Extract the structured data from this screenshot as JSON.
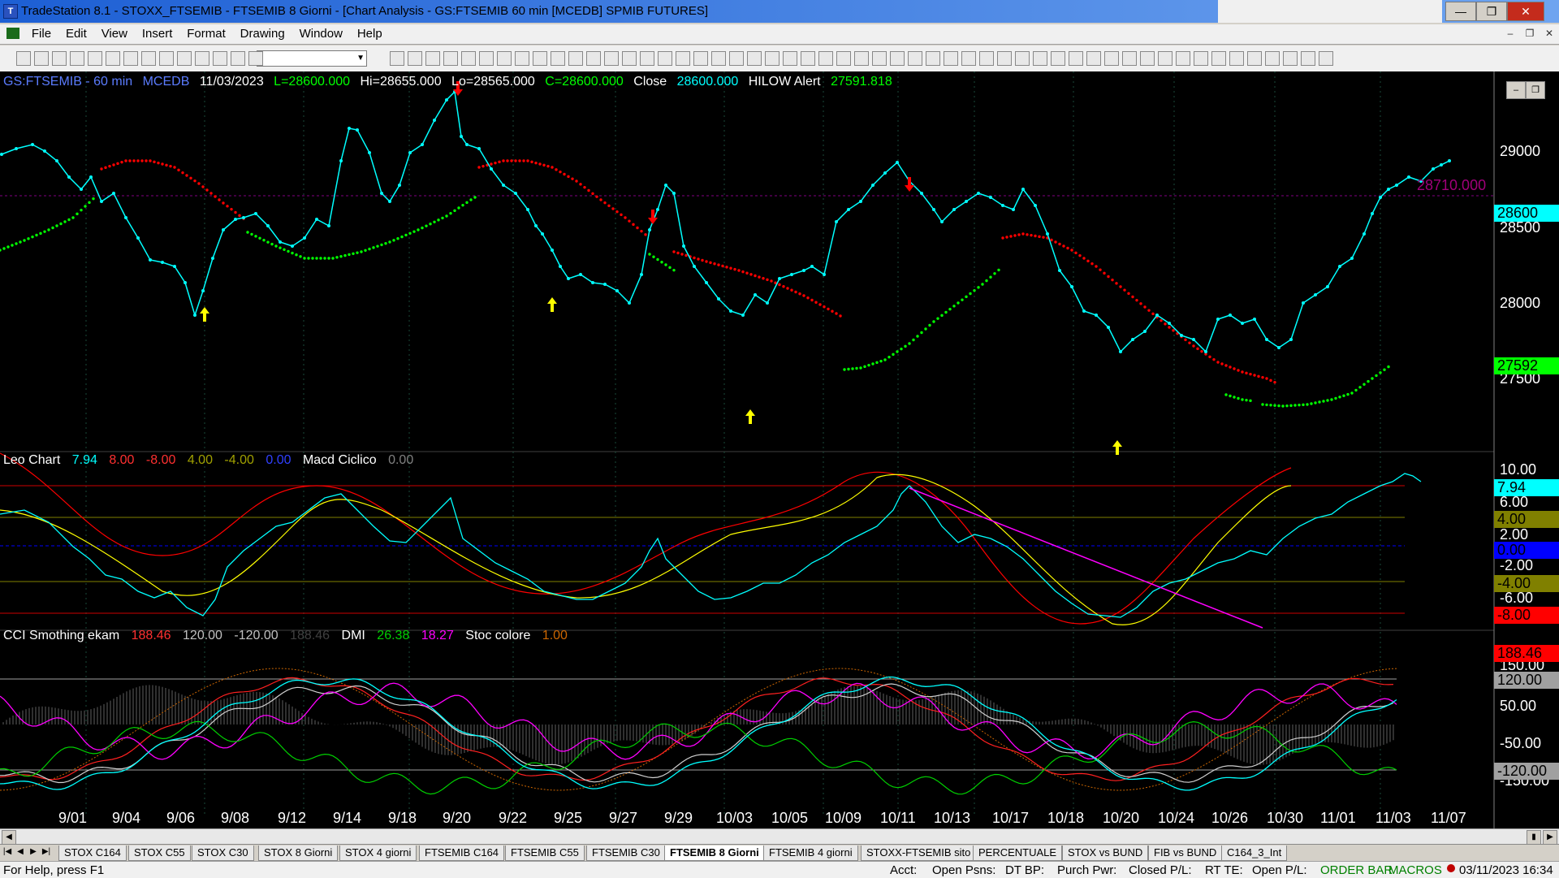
{
  "window": {
    "title": "TradeStation 8.1 - STOXX_FTSEMIB - FTSEMIB  8 Giorni - [Chart Analysis - GS:FTSEMIB  60 min  [MCEDB] SPMIB FUTURES]",
    "minimize": "—",
    "restore": "❐",
    "close": "✕"
  },
  "menu": [
    "File",
    "Edit",
    "View",
    "Insert",
    "Format",
    "Drawing",
    "Window",
    "Help"
  ],
  "chart_header": {
    "symbol": "GS:FTSEMIB - 60 min",
    "data_feed": "MCEDB",
    "date": "11/03/2023",
    "low_label": "L=28600.000",
    "high_label": "Hi=28655.000",
    "lo_label": "Lo=28565.000",
    "close_label": "C=28600.000",
    "close_word": "Close",
    "close_value": "28600.000",
    "alert_name": "HILOW Alert",
    "alert_value": "27591.818"
  },
  "price_axis": {
    "labels": [
      "29000",
      "28500",
      "28000",
      "27500"
    ],
    "ref_value_label": "28710.000",
    "current_tag": "28600",
    "alert_tag": "27592"
  },
  "macd_panel": {
    "name": "Leo Chart",
    "v1": "7.94",
    "v2": "8.00",
    "v3": "-8.00",
    "v4": "4.00",
    "v5": "-4.00",
    "v6": "0.00",
    "name2": "Macd Ciclico",
    "v7": "0.00",
    "axis": [
      "10.00",
      "6.00",
      "2.00",
      "-2.00",
      "-6.00"
    ],
    "tags": {
      "current": "7.94",
      "upper": "4.00",
      "zero": "0.00",
      "lower": "-4.00",
      "bottom": "-8.00"
    }
  },
  "cci_panel": {
    "name": "CCI Smothing ekam",
    "v1": "188.46",
    "v2": "120.00",
    "v3": "-120.00",
    "v4": "188.46",
    "dmi_name": "DMI",
    "dmi1": "26.38",
    "dmi2": "18.27",
    "stoc_name": "Stoc colore",
    "stoc_val": "1.00",
    "axis": [
      "150.00",
      "50.00",
      "-50.00",
      "-150.00"
    ],
    "tags": {
      "current": "188.46",
      "upper": "120.00",
      "lower": "-120.00"
    }
  },
  "date_axis": [
    "9/01",
    "9/04",
    "9/06",
    "9/08",
    "9/12",
    "9/14",
    "9/18",
    "9/20",
    "9/22",
    "9/25",
    "9/27",
    "9/29",
    "10/03",
    "10/05",
    "10/09",
    "10/11",
    "10/13",
    "10/17",
    "10/18",
    "10/20",
    "10/24",
    "10/26",
    "10/30",
    "11/01",
    "11/03",
    "11/07"
  ],
  "tabs": [
    "STOX C164",
    "STOX C55",
    "STOX  C30",
    "STOX  8 Giorni",
    "STOX 4 giorni",
    "FTSEMIB C164",
    "FTSEMIB C55",
    "FTSEMIB C30",
    "FTSEMIB  8 Giorni",
    "FTSEMIB  4 giorni",
    "STOXX-FTSEMIB sito",
    "PERCENTUALE",
    "STOX vs BUND",
    "FIB vs BUND",
    "C164_3_Int"
  ],
  "active_tab": "FTSEMIB  8 Giorni",
  "status": {
    "help": "For Help, press F1",
    "acct": "Acct:",
    "open_psns": "Open Psns:",
    "dt_bp": "DT BP:",
    "purch_pwr": "Purch Pwr:",
    "closed_pl": "Closed P/L:",
    "rt_te": "RT TE:",
    "open_pl": "Open P/L:",
    "order_bar": "ORDER BAR",
    "macros": "MACROS",
    "datetime": "03/11/2023 16:34"
  },
  "colors": {
    "price_line": "#00ffff",
    "upper_band": "#ff0000",
    "lower_band": "#00ff00",
    "up_arrow": "#ffff00",
    "down_arrow": "#ff0000",
    "magenta": "#ff00ff",
    "yellow_line": "#ffff00"
  }
}
